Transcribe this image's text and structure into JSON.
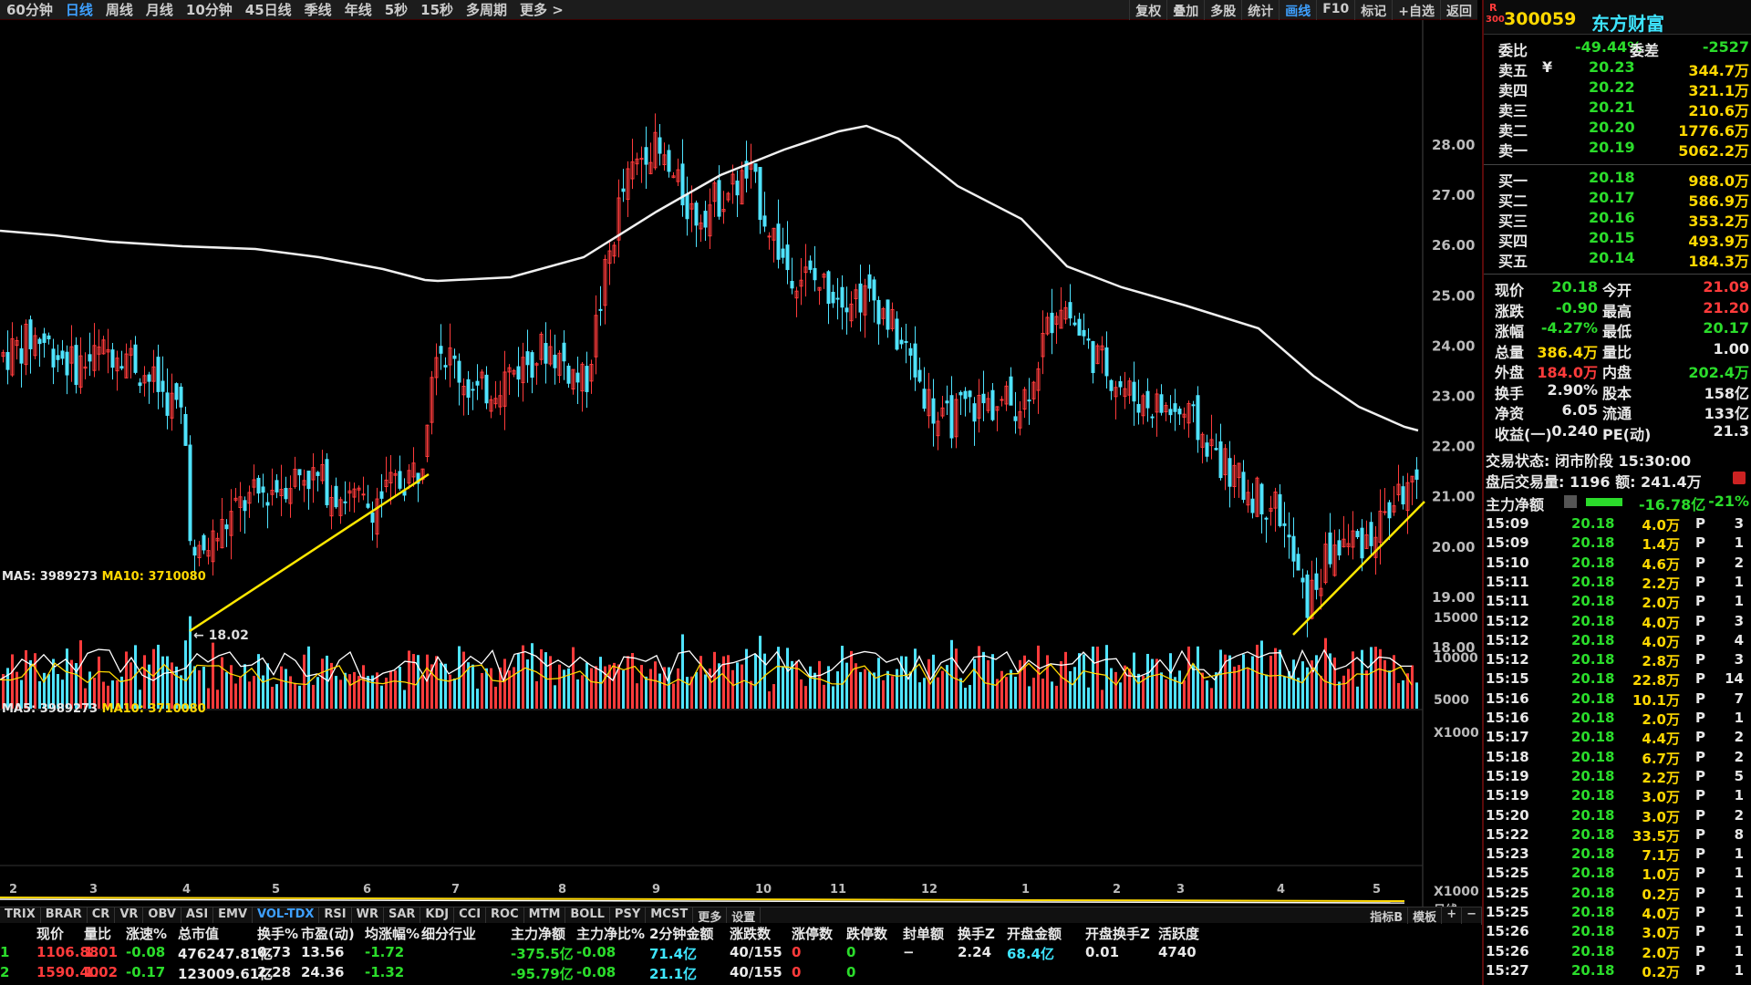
{
  "toolbar": {
    "periods": [
      "60分钟",
      "日线",
      "周线",
      "月线",
      "10分钟",
      "45日线",
      "季线",
      "年线",
      "5秒",
      "15秒",
      "多周期",
      "更多 >"
    ],
    "active_period": "日线",
    "tools": [
      "复权",
      "叠加",
      "多股",
      "统计",
      "画线",
      "F10",
      "标记",
      "+自选",
      "返回"
    ],
    "active_tool": "画线"
  },
  "chart": {
    "price_ticks": [
      "28.00",
      "27.00",
      "26.00",
      "25.00",
      "24.00",
      "23.00",
      "22.00",
      "21.00",
      "20.00",
      "19.00",
      "18.00"
    ],
    "low_marker": "18.02",
    "volume_ma_label_ma5": "MA5: 3989273",
    "volume_ma_label_ma10": "MA10: 3710080",
    "volume_ticks": [
      "15000",
      "10000",
      "5000",
      "X1000"
    ],
    "lower_ma_label_ma5": "MA5: 3989273",
    "lower_ma_label_ma10": "MA10: 3710080",
    "lower_unit": "X1000",
    "date_marks": [
      "2",
      "3",
      "4",
      "5",
      "6",
      "7",
      "8",
      "9",
      "10",
      "11",
      "12",
      "1",
      "2",
      "3",
      "4",
      "5"
    ],
    "date_axis_label": "日线"
  },
  "indicator_tabs": [
    "TRIX",
    "BRAR",
    "CR",
    "VR",
    "OBV",
    "ASI",
    "EMV",
    "VOL-TDX",
    "RSI",
    "WR",
    "SAR",
    "KDJ",
    "CCI",
    "ROC",
    "MTM",
    "BOLL",
    "PSY",
    "MCST",
    "更多",
    "设置"
  ],
  "active_indicator": "VOL-TDX",
  "indicator_right": [
    "指标B",
    "模板",
    "+",
    "−"
  ],
  "bottom_table": {
    "headers": [
      "现价",
      "量比",
      "涨速%",
      "总市值",
      "换手%",
      "市盈(动)",
      "均涨幅%",
      "细分行业",
      "主力净额",
      "主力净比%",
      "2分钟金额",
      "涨跌数",
      "涨停数",
      "跌停数",
      "封单额",
      "换手Z",
      "开盘金额",
      "开盘换手Z",
      "活跃度"
    ],
    "rows": [
      [
        "1106.88",
        "1.01",
        "-0.08",
        "476247.81亿",
        "0.73",
        "13.56",
        "-1.72",
        "",
        "-375.5亿",
        "-0.08",
        "71.4亿",
        "40/155",
        "0",
        "0",
        "−",
        "2.24",
        "68.4亿",
        "0.01",
        "4740"
      ],
      [
        "1590.40",
        "1.02",
        "-0.17",
        "123009.61亿",
        "2.28",
        "24.36",
        "-1.32",
        "",
        "-95.79亿",
        "-0.08",
        "21.1亿",
        "40/155",
        "0",
        "0",
        "",
        "",
        "",
        "",
        ""
      ]
    ]
  },
  "side": {
    "code": "300059",
    "name": "东方财富",
    "badge_top": "R",
    "badge_bottom": "300",
    "weibi_label": "委比",
    "weibi_value": "-49.44%",
    "weicha_label": "委差",
    "weicha_value": "-2527",
    "asks": [
      {
        "label": "卖五",
        "price": "20.23",
        "vol": "344.7万"
      },
      {
        "label": "卖四",
        "price": "20.22",
        "vol": "321.1万"
      },
      {
        "label": "卖三",
        "price": "20.21",
        "vol": "210.6万"
      },
      {
        "label": "卖二",
        "price": "20.20",
        "vol": "1776.6万"
      },
      {
        "label": "卖一",
        "price": "20.19",
        "vol": "5062.2万"
      }
    ],
    "bids": [
      {
        "label": "买一",
        "price": "20.18",
        "vol": "988.0万"
      },
      {
        "label": "买二",
        "price": "20.17",
        "vol": "586.9万"
      },
      {
        "label": "买三",
        "price": "20.16",
        "vol": "353.2万"
      },
      {
        "label": "买四",
        "price": "20.15",
        "vol": "493.9万"
      },
      {
        "label": "买五",
        "price": "20.14",
        "vol": "184.3万"
      }
    ],
    "yen": "¥",
    "stats": [
      {
        "l1": "现价",
        "v1": "20.18",
        "c1": "green",
        "l2": "今开",
        "v2": "21.09",
        "c2": "red"
      },
      {
        "l1": "涨跌",
        "v1": "-0.90",
        "c1": "green",
        "l2": "最高",
        "v2": "21.20",
        "c2": "red"
      },
      {
        "l1": "涨幅",
        "v1": "-4.27%",
        "c1": "green",
        "l2": "最低",
        "v2": "20.17",
        "c2": "green"
      },
      {
        "l1": "总量",
        "v1": "386.4万",
        "c1": "yellow",
        "l2": "量比",
        "v2": "1.00",
        "c2": "white"
      },
      {
        "l1": "外盘",
        "v1": "184.0万",
        "c1": "red",
        "l2": "内盘",
        "v2": "202.4万",
        "c2": "green"
      },
      {
        "l1": "换手",
        "v1": "2.90%",
        "c1": "white",
        "l2": "股本",
        "v2": "158亿",
        "c2": "white"
      },
      {
        "l1": "净资",
        "v1": "6.05",
        "c1": "white",
        "l2": "流通",
        "v2": "133亿",
        "c2": "white"
      },
      {
        "l1": "收益(一)",
        "v1": "0.240",
        "c1": "white",
        "l2": "PE(动)",
        "v2": "21.3",
        "c2": "white"
      }
    ],
    "trade_status": "交易状态: 闭市阶段 15:30:00",
    "after_hours": "盘后交易量: 1196  额: 241.4万",
    "main_net_label": "主力净额",
    "main_net_value": "-16.78亿",
    "main_net_pct": "-21%",
    "ticks": [
      {
        "t": "15:09",
        "p": "20.18",
        "v": "4.0万",
        "f": "P",
        "n": "3"
      },
      {
        "t": "15:09",
        "p": "20.18",
        "v": "1.4万",
        "f": "P",
        "n": "1"
      },
      {
        "t": "15:10",
        "p": "20.18",
        "v": "4.6万",
        "f": "P",
        "n": "2"
      },
      {
        "t": "15:11",
        "p": "20.18",
        "v": "2.2万",
        "f": "P",
        "n": "1"
      },
      {
        "t": "15:11",
        "p": "20.18",
        "v": "2.0万",
        "f": "P",
        "n": "1"
      },
      {
        "t": "15:12",
        "p": "20.18",
        "v": "4.0万",
        "f": "P",
        "n": "3"
      },
      {
        "t": "15:12",
        "p": "20.18",
        "v": "4.0万",
        "f": "P",
        "n": "4"
      },
      {
        "t": "15:12",
        "p": "20.18",
        "v": "2.8万",
        "f": "P",
        "n": "3"
      },
      {
        "t": "15:15",
        "p": "20.18",
        "v": "22.8万",
        "f": "P",
        "n": "14"
      },
      {
        "t": "15:16",
        "p": "20.18",
        "v": "10.1万",
        "f": "P",
        "n": "7"
      },
      {
        "t": "15:16",
        "p": "20.18",
        "v": "2.0万",
        "f": "P",
        "n": "1"
      },
      {
        "t": "15:17",
        "p": "20.18",
        "v": "4.4万",
        "f": "P",
        "n": "2"
      },
      {
        "t": "15:18",
        "p": "20.18",
        "v": "6.7万",
        "f": "P",
        "n": "2"
      },
      {
        "t": "15:19",
        "p": "20.18",
        "v": "2.2万",
        "f": "P",
        "n": "5"
      },
      {
        "t": "15:19",
        "p": "20.18",
        "v": "3.0万",
        "f": "P",
        "n": "1"
      },
      {
        "t": "15:20",
        "p": "20.18",
        "v": "3.0万",
        "f": "P",
        "n": "2"
      },
      {
        "t": "15:22",
        "p": "20.18",
        "v": "33.5万",
        "f": "P",
        "n": "8"
      },
      {
        "t": "15:23",
        "p": "20.18",
        "v": "7.1万",
        "f": "P",
        "n": "1"
      },
      {
        "t": "15:25",
        "p": "20.18",
        "v": "1.0万",
        "f": "P",
        "n": "1"
      },
      {
        "t": "15:25",
        "p": "20.18",
        "v": "0.2万",
        "f": "P",
        "n": "1"
      },
      {
        "t": "15:25",
        "p": "20.18",
        "v": "4.0万",
        "f": "P",
        "n": "1"
      },
      {
        "t": "15:26",
        "p": "20.18",
        "v": "3.0万",
        "f": "P",
        "n": "1"
      },
      {
        "t": "15:26",
        "p": "20.18",
        "v": "2.0万",
        "f": "P",
        "n": "1"
      },
      {
        "t": "15:27",
        "p": "20.18",
        "v": "0.2万",
        "f": "P",
        "n": "1"
      }
    ]
  },
  "colors": {
    "up": "#ff3b3b",
    "down": "#4fe3ff",
    "ma": "#f0f0f0",
    "trendline": "#ffe800",
    "accent": "#3ea0ff"
  }
}
